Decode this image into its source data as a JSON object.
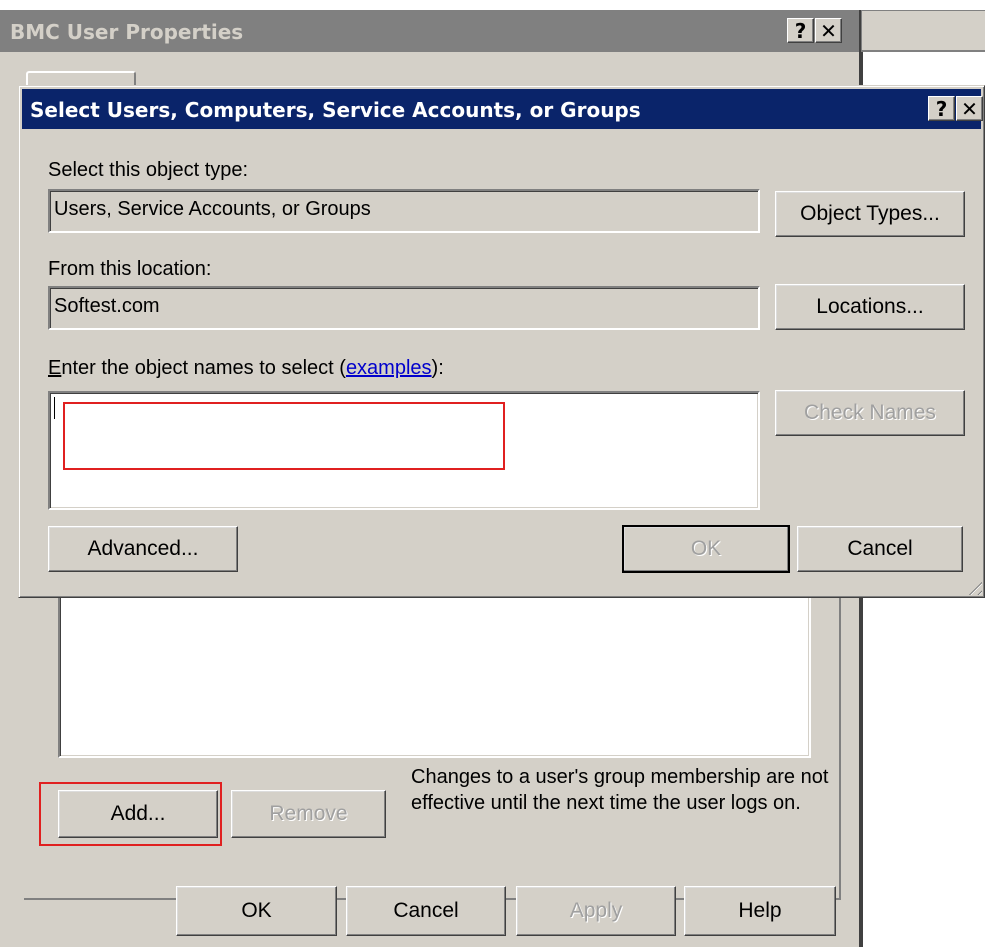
{
  "background_window": {
    "title": "BMC User Properties",
    "help_glyph": "?",
    "close_glyph": "✕",
    "add_button": "Add...",
    "remove_button": "Remove",
    "notice": "Changes to a user's group membership are not effective until the next time the user logs on.",
    "ok_button": "OK",
    "cancel_button": "Cancel",
    "apply_button": "Apply",
    "help_button": "Help"
  },
  "dialog": {
    "title": "Select Users, Computers, Service Accounts, or Groups",
    "help_glyph": "?",
    "close_glyph": "✕",
    "object_type_label": "Select this object type:",
    "object_type_value": "Users, Service Accounts, or Groups",
    "object_types_button": "Object Types...",
    "location_label": "From this location:",
    "location_value": "Softest.com",
    "locations_button": "Locations...",
    "names_label_prefix_underlined": "E",
    "names_label_rest": "nter the object names to select (",
    "names_label_link": "examples",
    "names_label_suffix": "):",
    "names_value": "",
    "check_names_button": "Check Names",
    "advanced_button": "Advanced...",
    "ok_button": "OK",
    "cancel_button": "Cancel"
  },
  "colors": {
    "active_titlebar": "#0a246a",
    "inactive_titlebar": "#808080",
    "face": "#d4d0c8",
    "highlight_box": "#e02020",
    "link": "#0000cc"
  }
}
